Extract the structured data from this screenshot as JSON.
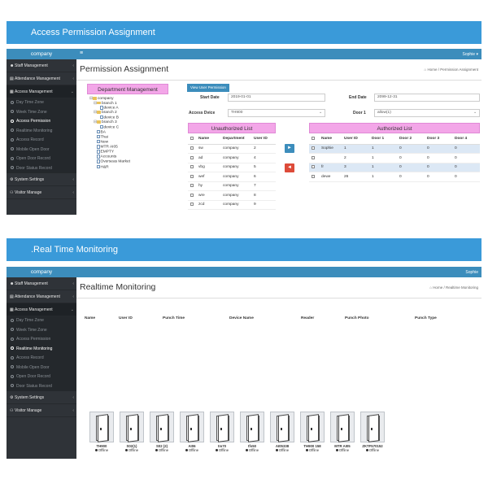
{
  "panel1": {
    "banner_title": "Access Permission Assignment",
    "brand": "company",
    "topbar_menu_icon": "hamburger-icon",
    "user": "Sophie",
    "page_title": "Permission Assignment",
    "breadcrumb": [
      "Home",
      "Permission Assignment"
    ],
    "sidebar": {
      "items": [
        {
          "label": "Staff Management",
          "icon": "user-icon"
        },
        {
          "label": "Attendance Management",
          "icon": "calendar-icon"
        },
        {
          "label": "Access Management",
          "icon": "grid-icon"
        }
      ],
      "sub_items": [
        "Day Time Zone",
        "Week Time Zone",
        "Access Permission",
        "Realtime Monitoring",
        "Access Record",
        "Mobile Open Door",
        "Open Door Record",
        "Door Status Record"
      ],
      "active_sub": "Access Permission",
      "bottom_items": [
        {
          "label": "System Settings",
          "icon": "gear-icon"
        },
        {
          "label": "Visitor Manage",
          "icon": "visitor-icon"
        }
      ]
    },
    "department": {
      "title": "Department Management",
      "tree": [
        {
          "label": "company",
          "type": "folder",
          "level": 0
        },
        {
          "label": "branch 1",
          "type": "folder",
          "level": 1
        },
        {
          "label": "device A",
          "type": "file",
          "level": 2
        },
        {
          "label": "branch 2",
          "type": "folder",
          "level": 1
        },
        {
          "label": "device B",
          "type": "file",
          "level": 2
        },
        {
          "label": "branch 3",
          "type": "folder",
          "level": 1
        },
        {
          "label": "device C",
          "type": "file",
          "level": 2
        },
        {
          "label": "BA",
          "type": "file",
          "level": 1
        },
        {
          "label": "Thai",
          "type": "file",
          "level": 1
        },
        {
          "label": "New",
          "type": "file",
          "level": 1
        },
        {
          "label": "MTR AI05",
          "type": "file",
          "level": 1
        },
        {
          "label": "EMPTY",
          "type": "file",
          "level": 1
        },
        {
          "label": "Accounts",
          "type": "file",
          "level": 1
        },
        {
          "label": "Overseas Market",
          "type": "file",
          "level": 1
        },
        {
          "label": "H&R",
          "type": "file",
          "level": 1
        }
      ]
    },
    "view_button": "View User Permission",
    "form": {
      "start_label": "Start Date",
      "start_value": "2019-01-01",
      "end_label": "End Date",
      "end_value": "2099-12-31",
      "device_label": "Access Dvice",
      "device_value": "TH900",
      "door_label": "Door 1",
      "door_value": "allow(1)"
    },
    "unauthorized": {
      "title": "Unauthorized List",
      "columns": [
        "",
        "Name",
        "Department",
        "User ID"
      ],
      "rows": [
        [
          "sw",
          "company",
          "2"
        ],
        [
          "ad",
          "company",
          "4"
        ],
        [
          "vbg",
          "company",
          "5"
        ],
        [
          "wef",
          "company",
          "6"
        ],
        [
          "hy",
          "company",
          "7"
        ],
        [
          "wre",
          "company",
          "8"
        ],
        [
          "zcd",
          "company",
          "9"
        ]
      ]
    },
    "authorized": {
      "title": "Authorized List",
      "columns": [
        "",
        "Name",
        "User ID",
        "Door 1",
        "Door 2",
        "Door 3",
        "Door 4"
      ],
      "rows": [
        [
          "Sophie",
          "1",
          "1",
          "0",
          "0",
          "0"
        ],
        [
          "",
          "2",
          "1",
          "0",
          "0",
          "0"
        ],
        [
          "fr",
          "3",
          "1",
          "0",
          "0",
          "0"
        ],
        [
          "dewe",
          "26",
          "1",
          "0",
          "0",
          "0"
        ]
      ]
    },
    "move_right_icon": "arrow-right-icon",
    "move_left_icon": "arrow-left-icon"
  },
  "panel2": {
    "banner_title": ".Real Time Monitoring",
    "brand": "company",
    "user": "Sophie",
    "page_title": "Realtime Monitoring",
    "breadcrumb": [
      "Home",
      "Realtime Monitoring"
    ],
    "sidebar": {
      "items": [
        {
          "label": "Staff Management",
          "icon": "user-icon"
        },
        {
          "label": "Attendance Management",
          "icon": "calendar-icon"
        },
        {
          "label": "Access Management",
          "icon": "grid-icon"
        }
      ],
      "sub_items": [
        "Day Time Zone",
        "Week Time Zone",
        "Access Permission",
        "Realtime Monitoring",
        "Access Record",
        "Mobile Open Door",
        "Open Door Record",
        "Door Status Record"
      ],
      "active_sub": "Realtime Monitoring",
      "bottom_items": [
        {
          "label": "System Settings",
          "icon": "gear-icon"
        },
        {
          "label": "Visitor Manage",
          "icon": "visitor-icon"
        }
      ]
    },
    "columns": [
      "Name",
      "User ID",
      "Punch Time",
      "Device Name",
      "Reader",
      "Punch Photo",
      "Punch Type"
    ],
    "doors": [
      {
        "name": "TH900",
        "status": "Offline"
      },
      {
        "name": "S02(1)",
        "status": "Offline"
      },
      {
        "name": "S02 (2)",
        "status": "Offline"
      },
      {
        "name": "AI06",
        "status": "Offline"
      },
      {
        "name": "tm70",
        "status": "Offline"
      },
      {
        "name": "tfs50",
        "status": "Offline"
      },
      {
        "name": "AI05338",
        "status": "Offline"
      },
      {
        "name": "TH900 158",
        "status": "Offline"
      },
      {
        "name": "MTR AI05",
        "status": "Offline"
      },
      {
        "name": "ZKTF570152",
        "status": "Offline"
      }
    ]
  },
  "colors": {
    "brand_blue": "#3c8dbc",
    "banner_blue": "#3a9ad9",
    "sidebar_dark": "#2f3338",
    "list_header_pink": "#f3a6e8",
    "remove_red": "#dd4b39"
  }
}
